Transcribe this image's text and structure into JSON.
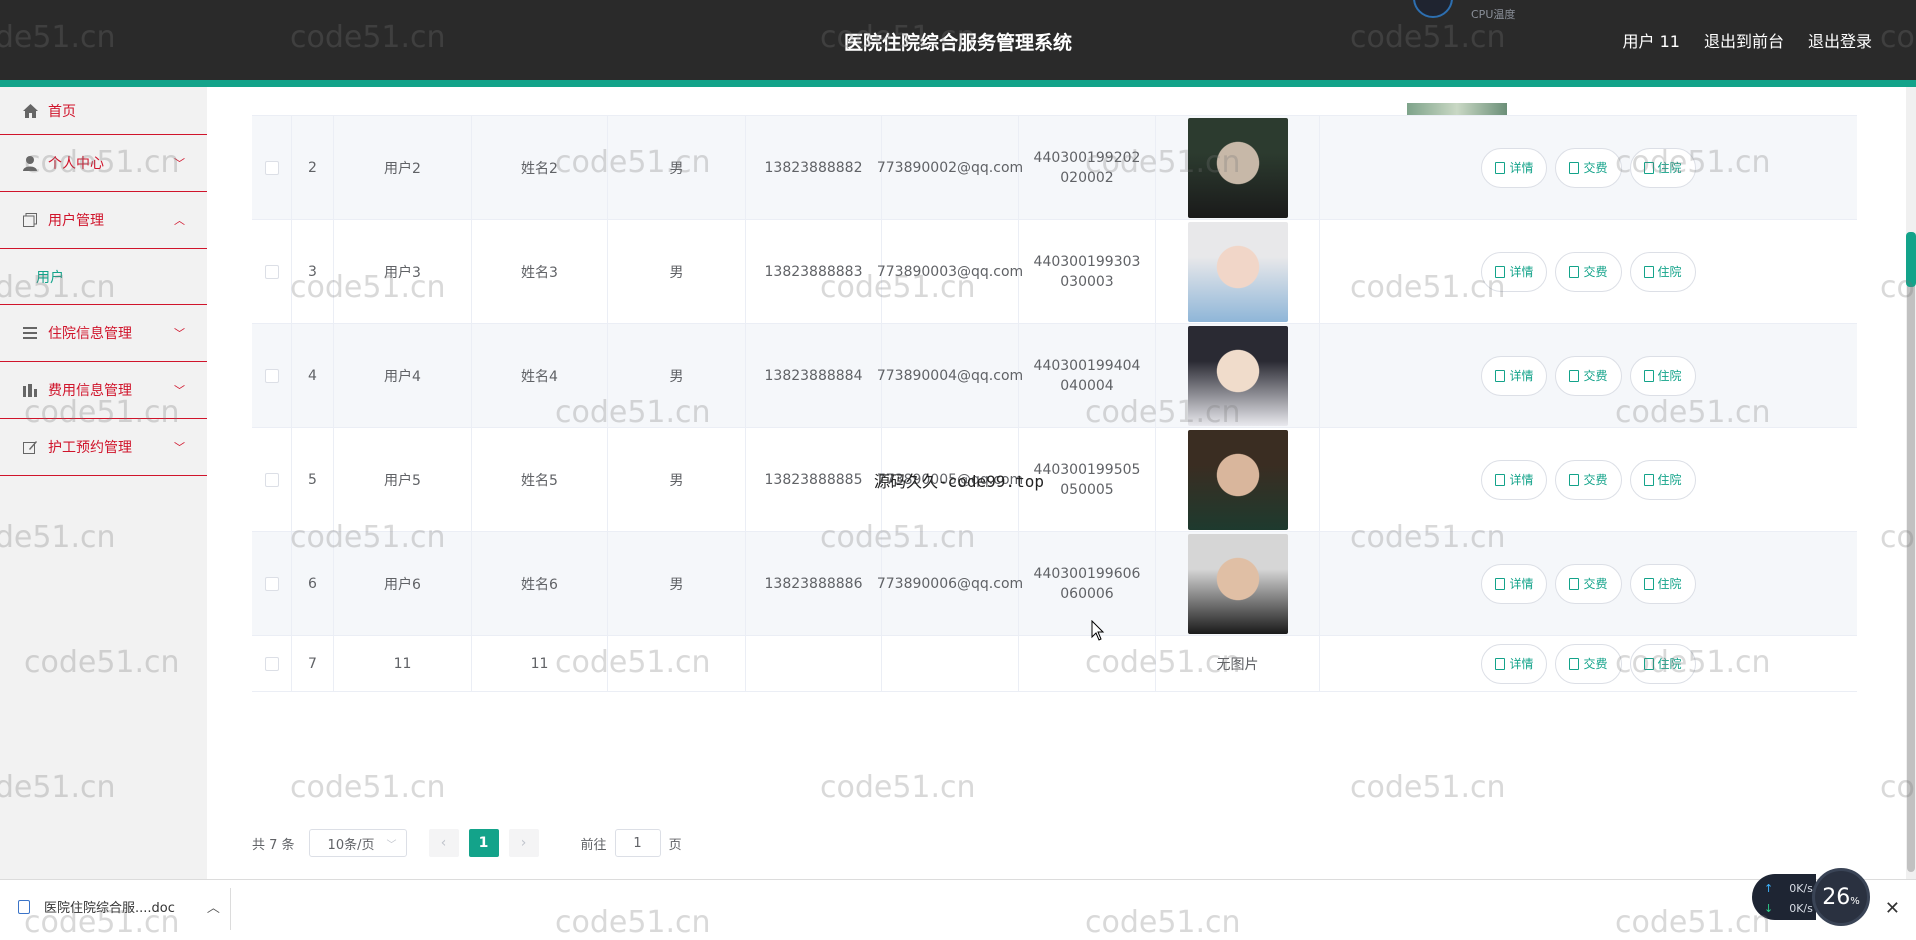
{
  "header": {
    "title": "医院住院综合服务管理系统",
    "cpu_label": "CPU温度",
    "links": [
      "用户 11",
      "退出到前台",
      "退出登录"
    ]
  },
  "sidebar": {
    "items": [
      {
        "label": "首页",
        "icon": "home-icon"
      },
      {
        "label": "个人中心",
        "icon": "user-icon",
        "arrow": "﹀"
      },
      {
        "label": "用户管理",
        "icon": "copy-icon",
        "arrow": "︿",
        "sub": [
          "用户"
        ]
      },
      {
        "label": "住院信息管理",
        "icon": "list-icon",
        "arrow": "﹀"
      },
      {
        "label": "费用信息管理",
        "icon": "chart-icon",
        "arrow": "﹀"
      },
      {
        "label": "护工预约管理",
        "icon": "edit-icon",
        "arrow": "﹀"
      }
    ]
  },
  "table": {
    "rows": [
      {
        "index": "2",
        "username": "用户2",
        "name": "姓名2",
        "gender": "男",
        "phone": "13823888882",
        "email": "773890002@qq.com",
        "idcard": "440300199202020002",
        "photo": "avatar"
      },
      {
        "index": "3",
        "username": "用户3",
        "name": "姓名3",
        "gender": "男",
        "phone": "13823888883",
        "email": "773890003@qq.com",
        "idcard": "440300199303030003",
        "photo": "avatar"
      },
      {
        "index": "4",
        "username": "用户4",
        "name": "姓名4",
        "gender": "男",
        "phone": "13823888884",
        "email": "773890004@qq.com",
        "idcard": "440300199404040004",
        "photo": "avatar"
      },
      {
        "index": "5",
        "username": "用户5",
        "name": "姓名5",
        "gender": "男",
        "phone": "13823888885",
        "email": "773890005@qq.com",
        "idcard": "440300199505050005",
        "photo": "avatar"
      },
      {
        "index": "6",
        "username": "用户6",
        "name": "姓名6",
        "gender": "男",
        "phone": "13823888886",
        "email": "773890006@qq.com",
        "idcard": "440300199606060006",
        "photo": "avatar"
      },
      {
        "index": "7",
        "username": "11",
        "name": "11",
        "gender": "",
        "phone": "",
        "email": "",
        "idcard": "",
        "photo": "无图片"
      }
    ],
    "actions": [
      "详情",
      "交费",
      "住院"
    ]
  },
  "pagination": {
    "total": "共 7 条",
    "page_size": "10条/页",
    "current_page": "1",
    "goto_prefix": "前往",
    "goto_value": "1",
    "goto_suffix": "页"
  },
  "overlay_text": "源码久久-code99.top",
  "download": {
    "file_name": "医院住院综合服....doc"
  },
  "system": {
    "net_up": "0K/s",
    "net_down": "0K/s",
    "cpu_value": "26",
    "cpu_unit": "%"
  },
  "watermark": "code51.cn",
  "colors": {
    "accent": "#13a38a",
    "menu_text": "#d0142b",
    "header_bg": "#2a2a2a"
  }
}
